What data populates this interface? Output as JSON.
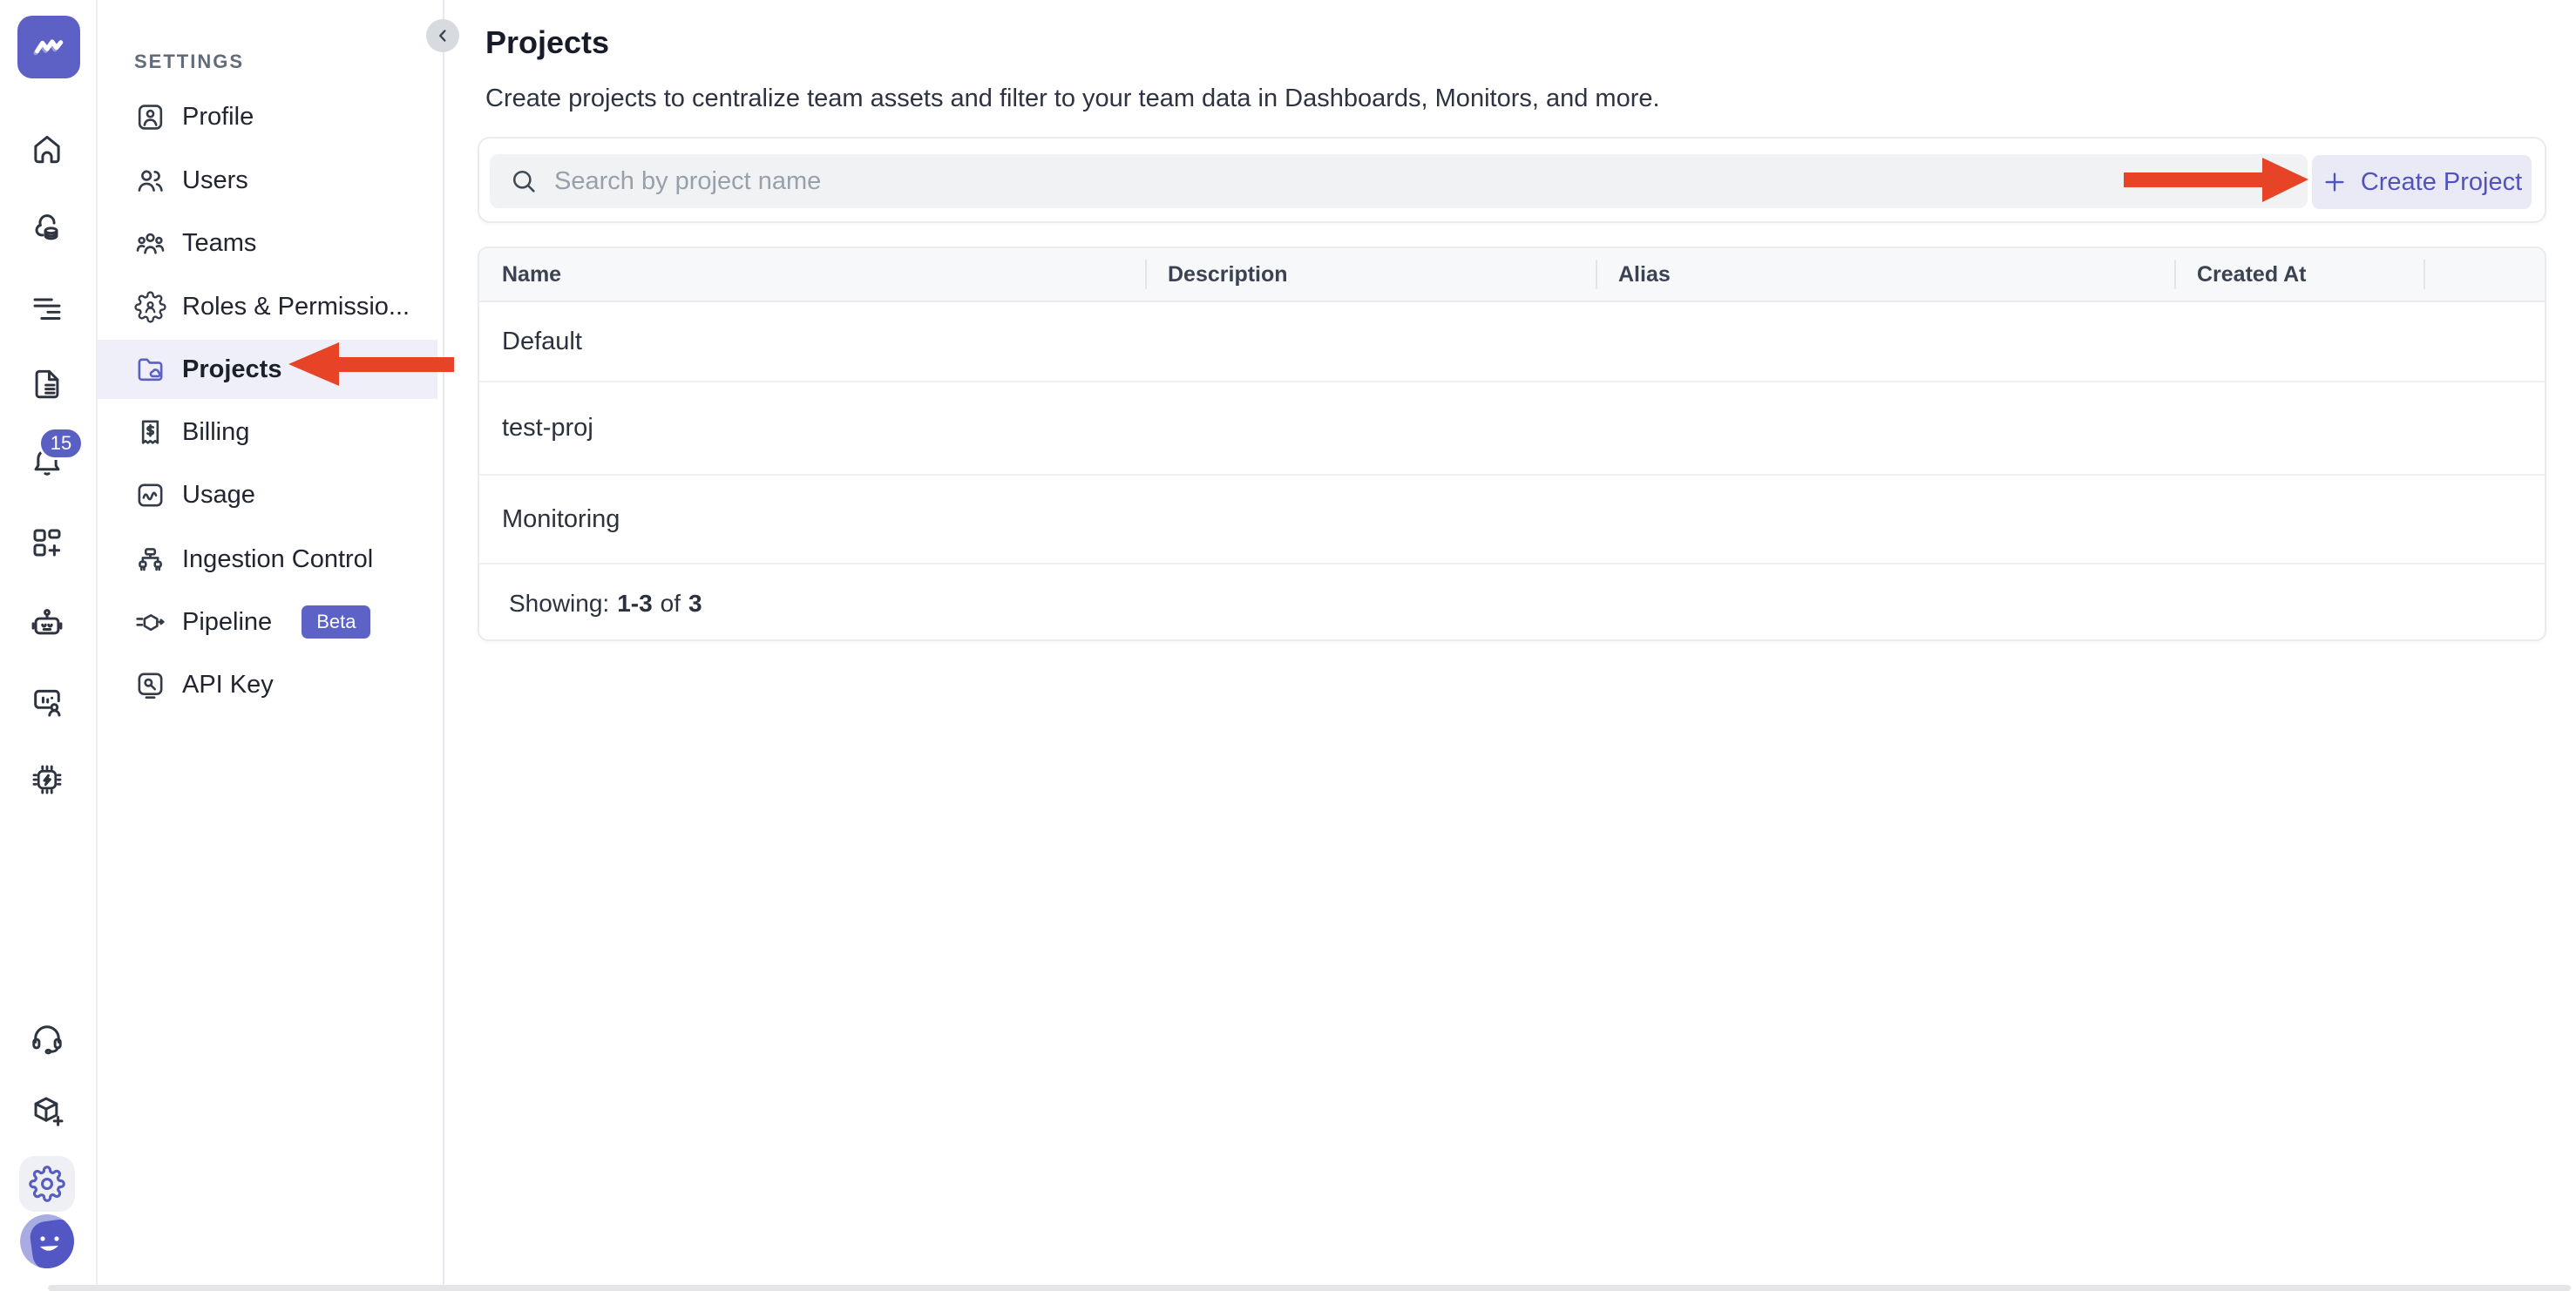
{
  "app": {
    "logo_icon": "middleware-zigzag-logo",
    "colors": {
      "accent": "#5d61c6",
      "accent_light_bg": "#e9eaf6",
      "active_item_bg": "#eeeff8",
      "arrow_red": "#e74327",
      "table_header_bg": "#f7f8fa",
      "border": "#e9ebef"
    }
  },
  "rail": {
    "badge_count": "15",
    "icons": [
      "home-icon",
      "cloud-cost-icon",
      "logs-icon",
      "reports-icon",
      "alerts-bell-icon",
      "dashboards-grid-icon",
      "bot-icon",
      "session-chat-icon",
      "chip-icon",
      "support-headset-icon",
      "install-cube-icon",
      "settings-gear-icon",
      "user-avatar"
    ]
  },
  "sidebar": {
    "header": "SETTINGS",
    "collapse_icon": "chevron-left-icon",
    "items": [
      {
        "label": "Profile",
        "icon": "profile-icon"
      },
      {
        "label": "Users",
        "icon": "users-icon"
      },
      {
        "label": "Teams",
        "icon": "teams-icon"
      },
      {
        "label": "Roles & Permissio...",
        "icon": "roles-gear-person-icon"
      },
      {
        "label": "Projects",
        "icon": "folder-cloud-icon",
        "active": true
      },
      {
        "label": "Billing",
        "icon": "billing-receipt-icon"
      },
      {
        "label": "Usage",
        "icon": "usage-chart-icon"
      },
      {
        "label": "Ingestion Control",
        "icon": "ingestion-tree-icon"
      },
      {
        "label": "Pipeline",
        "icon": "pipeline-hexagon-icon",
        "badge": "Beta"
      },
      {
        "label": "API Key",
        "icon": "api-key-icon"
      }
    ]
  },
  "main": {
    "title": "Projects",
    "description": "Create projects to centralize team assets and filter to your team data in Dashboards, Monitors, and more.",
    "search": {
      "placeholder": "Search by project name",
      "icon": "search-icon"
    },
    "create_button": {
      "label": "Create Project",
      "icon": "plus-icon"
    },
    "table": {
      "columns": [
        "Name",
        "Description",
        "Alias",
        "Created At",
        ""
      ],
      "rows": [
        {
          "name": "Default",
          "description": "",
          "alias": "",
          "created_at": ""
        },
        {
          "name": "test-proj",
          "description": "",
          "alias": "",
          "created_at": ""
        },
        {
          "name": "Monitoring",
          "description": "",
          "alias": "",
          "created_at": ""
        }
      ],
      "footer": {
        "label": "Showing:",
        "range": "1-3",
        "of": "of",
        "total": "3"
      }
    }
  },
  "annotations": {
    "arrow_color": "#e74327",
    "arrows": [
      "arrow-to-projects-item",
      "arrow-to-create-project-button"
    ]
  }
}
